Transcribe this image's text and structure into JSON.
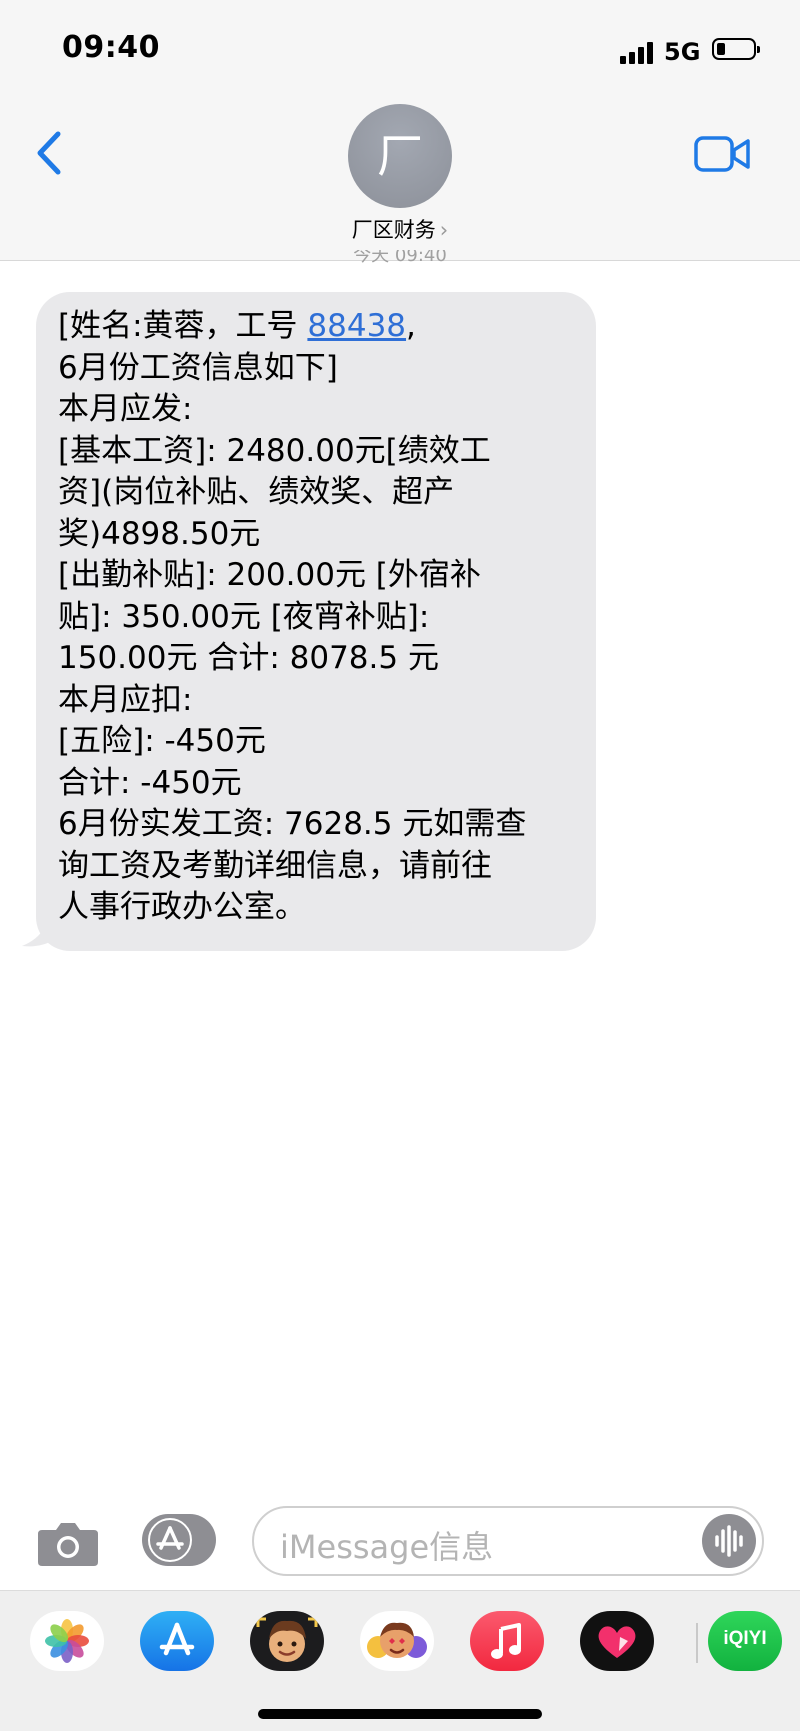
{
  "status_bar": {
    "time": "09:40",
    "network": "5G"
  },
  "header": {
    "avatar_initial": "厂",
    "contact_name": "厂区财务",
    "chevron": "›",
    "timestamp": "今天 09:40"
  },
  "message": {
    "lines": [
      {
        "pre": "[姓名:黄蓉，工号 ",
        "link": "88438",
        "post": ","
      },
      "6月份工资信息如下]",
      "本月应发:",
      "[基本工资]: 2480.00元[绩效工",
      "资](岗位补贴、绩效奖、超产",
      "奖)4898.50元",
      "[出勤补贴]: 200.00元 [外宿补",
      "贴]: 350.00元 [夜宵补贴]:",
      "150.00元 合计: 8078.5 元",
      "本月应扣:",
      "[五险]: -450元",
      "合计: -450元",
      "6月份实发工资: 7628.5 元如需查",
      "询工资及考勤详细信息，请前往",
      "人事行政办公室。"
    ]
  },
  "compose": {
    "placeholder": "iMessage信息"
  },
  "drawer": {
    "apps": [
      "photos-app",
      "app-store",
      "memoji-app",
      "animoji-app",
      "music-app",
      "heart-app",
      "iqiyi-app"
    ],
    "iqiyi_label": "iQIYI"
  },
  "colors": {
    "accent": "#1f7ae6",
    "bubble": "#e9e9eb",
    "link": "#2f6fd6"
  }
}
